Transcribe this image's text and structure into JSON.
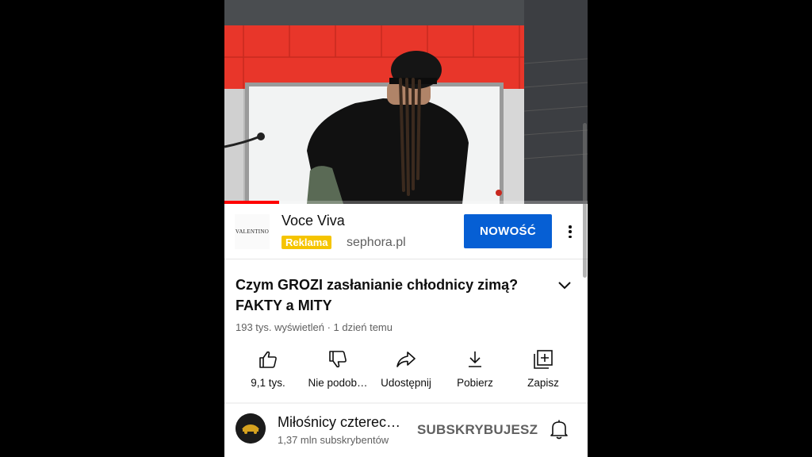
{
  "video": {
    "progress": 0.15
  },
  "ad": {
    "logo_text": "VALENTINO",
    "title": "Voce Viva",
    "badge": "Reklama",
    "domain": "sephora.pl",
    "cta_label": "NOWOŚĆ"
  },
  "video_info": {
    "title": "Czym GROZI zasłanianie chłodnicy zimą? FAKTY a MITY",
    "meta": "193 tys. wyświetleń · 1 dzień temu"
  },
  "actions": [
    {
      "label": "9,1 tys.",
      "icon": "thumbs-up-icon"
    },
    {
      "label": "Nie podob…",
      "icon": "thumbs-down-icon"
    },
    {
      "label": "Udostępnij",
      "icon": "share-icon"
    },
    {
      "label": "Pobierz",
      "icon": "download-icon"
    },
    {
      "label": "Zapisz",
      "icon": "save-playlist-icon"
    }
  ],
  "channel": {
    "name": "Miłośnicy czterec…",
    "subscribers": "1,37 mln subskrybentów",
    "subscribe_label": "SUBSKRYBUJESZ"
  },
  "colors": {
    "accent_blue": "#065fd4",
    "ad_badge": "#f5c400",
    "progress_red": "#ff0000"
  }
}
